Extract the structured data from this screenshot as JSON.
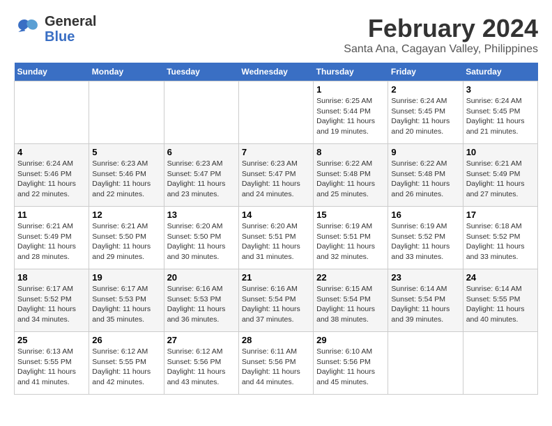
{
  "header": {
    "logo_general": "General",
    "logo_blue": "Blue",
    "month": "February 2024",
    "location": "Santa Ana, Cagayan Valley, Philippines"
  },
  "columns": [
    "Sunday",
    "Monday",
    "Tuesday",
    "Wednesday",
    "Thursday",
    "Friday",
    "Saturday"
  ],
  "weeks": [
    [
      {
        "day": "",
        "sunrise": "",
        "sunset": "",
        "daylight": ""
      },
      {
        "day": "",
        "sunrise": "",
        "sunset": "",
        "daylight": ""
      },
      {
        "day": "",
        "sunrise": "",
        "sunset": "",
        "daylight": ""
      },
      {
        "day": "",
        "sunrise": "",
        "sunset": "",
        "daylight": ""
      },
      {
        "day": "1",
        "sunrise": "Sunrise: 6:25 AM",
        "sunset": "Sunset: 5:44 PM",
        "daylight": "Daylight: 11 hours and 19 minutes."
      },
      {
        "day": "2",
        "sunrise": "Sunrise: 6:24 AM",
        "sunset": "Sunset: 5:45 PM",
        "daylight": "Daylight: 11 hours and 20 minutes."
      },
      {
        "day": "3",
        "sunrise": "Sunrise: 6:24 AM",
        "sunset": "Sunset: 5:45 PM",
        "daylight": "Daylight: 11 hours and 21 minutes."
      }
    ],
    [
      {
        "day": "4",
        "sunrise": "Sunrise: 6:24 AM",
        "sunset": "Sunset: 5:46 PM",
        "daylight": "Daylight: 11 hours and 22 minutes."
      },
      {
        "day": "5",
        "sunrise": "Sunrise: 6:23 AM",
        "sunset": "Sunset: 5:46 PM",
        "daylight": "Daylight: 11 hours and 22 minutes."
      },
      {
        "day": "6",
        "sunrise": "Sunrise: 6:23 AM",
        "sunset": "Sunset: 5:47 PM",
        "daylight": "Daylight: 11 hours and 23 minutes."
      },
      {
        "day": "7",
        "sunrise": "Sunrise: 6:23 AM",
        "sunset": "Sunset: 5:47 PM",
        "daylight": "Daylight: 11 hours and 24 minutes."
      },
      {
        "day": "8",
        "sunrise": "Sunrise: 6:22 AM",
        "sunset": "Sunset: 5:48 PM",
        "daylight": "Daylight: 11 hours and 25 minutes."
      },
      {
        "day": "9",
        "sunrise": "Sunrise: 6:22 AM",
        "sunset": "Sunset: 5:48 PM",
        "daylight": "Daylight: 11 hours and 26 minutes."
      },
      {
        "day": "10",
        "sunrise": "Sunrise: 6:21 AM",
        "sunset": "Sunset: 5:49 PM",
        "daylight": "Daylight: 11 hours and 27 minutes."
      }
    ],
    [
      {
        "day": "11",
        "sunrise": "Sunrise: 6:21 AM",
        "sunset": "Sunset: 5:49 PM",
        "daylight": "Daylight: 11 hours and 28 minutes."
      },
      {
        "day": "12",
        "sunrise": "Sunrise: 6:21 AM",
        "sunset": "Sunset: 5:50 PM",
        "daylight": "Daylight: 11 hours and 29 minutes."
      },
      {
        "day": "13",
        "sunrise": "Sunrise: 6:20 AM",
        "sunset": "Sunset: 5:50 PM",
        "daylight": "Daylight: 11 hours and 30 minutes."
      },
      {
        "day": "14",
        "sunrise": "Sunrise: 6:20 AM",
        "sunset": "Sunset: 5:51 PM",
        "daylight": "Daylight: 11 hours and 31 minutes."
      },
      {
        "day": "15",
        "sunrise": "Sunrise: 6:19 AM",
        "sunset": "Sunset: 5:51 PM",
        "daylight": "Daylight: 11 hours and 32 minutes."
      },
      {
        "day": "16",
        "sunrise": "Sunrise: 6:19 AM",
        "sunset": "Sunset: 5:52 PM",
        "daylight": "Daylight: 11 hours and 33 minutes."
      },
      {
        "day": "17",
        "sunrise": "Sunrise: 6:18 AM",
        "sunset": "Sunset: 5:52 PM",
        "daylight": "Daylight: 11 hours and 33 minutes."
      }
    ],
    [
      {
        "day": "18",
        "sunrise": "Sunrise: 6:17 AM",
        "sunset": "Sunset: 5:52 PM",
        "daylight": "Daylight: 11 hours and 34 minutes."
      },
      {
        "day": "19",
        "sunrise": "Sunrise: 6:17 AM",
        "sunset": "Sunset: 5:53 PM",
        "daylight": "Daylight: 11 hours and 35 minutes."
      },
      {
        "day": "20",
        "sunrise": "Sunrise: 6:16 AM",
        "sunset": "Sunset: 5:53 PM",
        "daylight": "Daylight: 11 hours and 36 minutes."
      },
      {
        "day": "21",
        "sunrise": "Sunrise: 6:16 AM",
        "sunset": "Sunset: 5:54 PM",
        "daylight": "Daylight: 11 hours and 37 minutes."
      },
      {
        "day": "22",
        "sunrise": "Sunrise: 6:15 AM",
        "sunset": "Sunset: 5:54 PM",
        "daylight": "Daylight: 11 hours and 38 minutes."
      },
      {
        "day": "23",
        "sunrise": "Sunrise: 6:14 AM",
        "sunset": "Sunset: 5:54 PM",
        "daylight": "Daylight: 11 hours and 39 minutes."
      },
      {
        "day": "24",
        "sunrise": "Sunrise: 6:14 AM",
        "sunset": "Sunset: 5:55 PM",
        "daylight": "Daylight: 11 hours and 40 minutes."
      }
    ],
    [
      {
        "day": "25",
        "sunrise": "Sunrise: 6:13 AM",
        "sunset": "Sunset: 5:55 PM",
        "daylight": "Daylight: 11 hours and 41 minutes."
      },
      {
        "day": "26",
        "sunrise": "Sunrise: 6:12 AM",
        "sunset": "Sunset: 5:55 PM",
        "daylight": "Daylight: 11 hours and 42 minutes."
      },
      {
        "day": "27",
        "sunrise": "Sunrise: 6:12 AM",
        "sunset": "Sunset: 5:56 PM",
        "daylight": "Daylight: 11 hours and 43 minutes."
      },
      {
        "day": "28",
        "sunrise": "Sunrise: 6:11 AM",
        "sunset": "Sunset: 5:56 PM",
        "daylight": "Daylight: 11 hours and 44 minutes."
      },
      {
        "day": "29",
        "sunrise": "Sunrise: 6:10 AM",
        "sunset": "Sunset: 5:56 PM",
        "daylight": "Daylight: 11 hours and 45 minutes."
      },
      {
        "day": "",
        "sunrise": "",
        "sunset": "",
        "daylight": ""
      },
      {
        "day": "",
        "sunrise": "",
        "sunset": "",
        "daylight": ""
      }
    ]
  ]
}
